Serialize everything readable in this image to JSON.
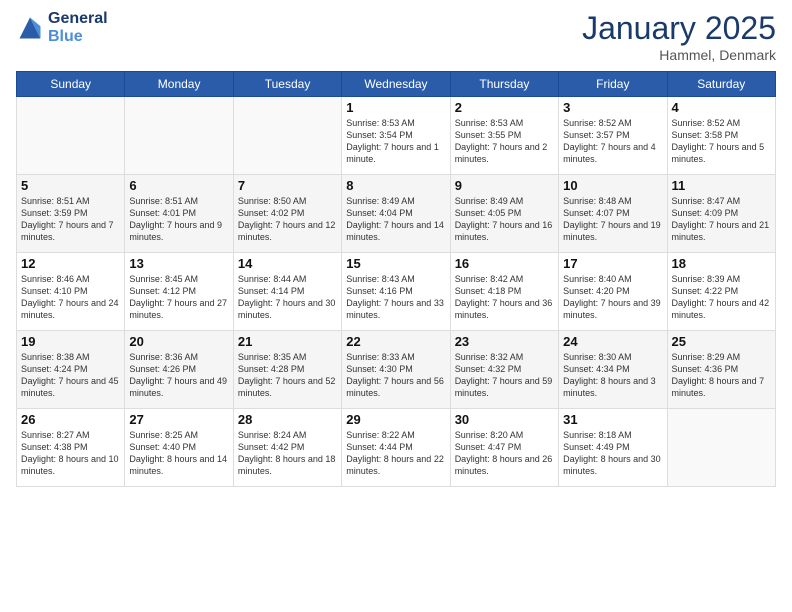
{
  "header": {
    "logo_line1": "General",
    "logo_line2": "Blue",
    "month": "January 2025",
    "location": "Hammel, Denmark"
  },
  "weekdays": [
    "Sunday",
    "Monday",
    "Tuesday",
    "Wednesday",
    "Thursday",
    "Friday",
    "Saturday"
  ],
  "weeks": [
    [
      {
        "day": "",
        "content": ""
      },
      {
        "day": "",
        "content": ""
      },
      {
        "day": "",
        "content": ""
      },
      {
        "day": "1",
        "content": "Sunrise: 8:53 AM\nSunset: 3:54 PM\nDaylight: 7 hours and 1 minute."
      },
      {
        "day": "2",
        "content": "Sunrise: 8:53 AM\nSunset: 3:55 PM\nDaylight: 7 hours and 2 minutes."
      },
      {
        "day": "3",
        "content": "Sunrise: 8:52 AM\nSunset: 3:57 PM\nDaylight: 7 hours and 4 minutes."
      },
      {
        "day": "4",
        "content": "Sunrise: 8:52 AM\nSunset: 3:58 PM\nDaylight: 7 hours and 5 minutes."
      }
    ],
    [
      {
        "day": "5",
        "content": "Sunrise: 8:51 AM\nSunset: 3:59 PM\nDaylight: 7 hours and 7 minutes."
      },
      {
        "day": "6",
        "content": "Sunrise: 8:51 AM\nSunset: 4:01 PM\nDaylight: 7 hours and 9 minutes."
      },
      {
        "day": "7",
        "content": "Sunrise: 8:50 AM\nSunset: 4:02 PM\nDaylight: 7 hours and 12 minutes."
      },
      {
        "day": "8",
        "content": "Sunrise: 8:49 AM\nSunset: 4:04 PM\nDaylight: 7 hours and 14 minutes."
      },
      {
        "day": "9",
        "content": "Sunrise: 8:49 AM\nSunset: 4:05 PM\nDaylight: 7 hours and 16 minutes."
      },
      {
        "day": "10",
        "content": "Sunrise: 8:48 AM\nSunset: 4:07 PM\nDaylight: 7 hours and 19 minutes."
      },
      {
        "day": "11",
        "content": "Sunrise: 8:47 AM\nSunset: 4:09 PM\nDaylight: 7 hours and 21 minutes."
      }
    ],
    [
      {
        "day": "12",
        "content": "Sunrise: 8:46 AM\nSunset: 4:10 PM\nDaylight: 7 hours and 24 minutes."
      },
      {
        "day": "13",
        "content": "Sunrise: 8:45 AM\nSunset: 4:12 PM\nDaylight: 7 hours and 27 minutes."
      },
      {
        "day": "14",
        "content": "Sunrise: 8:44 AM\nSunset: 4:14 PM\nDaylight: 7 hours and 30 minutes."
      },
      {
        "day": "15",
        "content": "Sunrise: 8:43 AM\nSunset: 4:16 PM\nDaylight: 7 hours and 33 minutes."
      },
      {
        "day": "16",
        "content": "Sunrise: 8:42 AM\nSunset: 4:18 PM\nDaylight: 7 hours and 36 minutes."
      },
      {
        "day": "17",
        "content": "Sunrise: 8:40 AM\nSunset: 4:20 PM\nDaylight: 7 hours and 39 minutes."
      },
      {
        "day": "18",
        "content": "Sunrise: 8:39 AM\nSunset: 4:22 PM\nDaylight: 7 hours and 42 minutes."
      }
    ],
    [
      {
        "day": "19",
        "content": "Sunrise: 8:38 AM\nSunset: 4:24 PM\nDaylight: 7 hours and 45 minutes."
      },
      {
        "day": "20",
        "content": "Sunrise: 8:36 AM\nSunset: 4:26 PM\nDaylight: 7 hours and 49 minutes."
      },
      {
        "day": "21",
        "content": "Sunrise: 8:35 AM\nSunset: 4:28 PM\nDaylight: 7 hours and 52 minutes."
      },
      {
        "day": "22",
        "content": "Sunrise: 8:33 AM\nSunset: 4:30 PM\nDaylight: 7 hours and 56 minutes."
      },
      {
        "day": "23",
        "content": "Sunrise: 8:32 AM\nSunset: 4:32 PM\nDaylight: 7 hours and 59 minutes."
      },
      {
        "day": "24",
        "content": "Sunrise: 8:30 AM\nSunset: 4:34 PM\nDaylight: 8 hours and 3 minutes."
      },
      {
        "day": "25",
        "content": "Sunrise: 8:29 AM\nSunset: 4:36 PM\nDaylight: 8 hours and 7 minutes."
      }
    ],
    [
      {
        "day": "26",
        "content": "Sunrise: 8:27 AM\nSunset: 4:38 PM\nDaylight: 8 hours and 10 minutes."
      },
      {
        "day": "27",
        "content": "Sunrise: 8:25 AM\nSunset: 4:40 PM\nDaylight: 8 hours and 14 minutes."
      },
      {
        "day": "28",
        "content": "Sunrise: 8:24 AM\nSunset: 4:42 PM\nDaylight: 8 hours and 18 minutes."
      },
      {
        "day": "29",
        "content": "Sunrise: 8:22 AM\nSunset: 4:44 PM\nDaylight: 8 hours and 22 minutes."
      },
      {
        "day": "30",
        "content": "Sunrise: 8:20 AM\nSunset: 4:47 PM\nDaylight: 8 hours and 26 minutes."
      },
      {
        "day": "31",
        "content": "Sunrise: 8:18 AM\nSunset: 4:49 PM\nDaylight: 8 hours and 30 minutes."
      },
      {
        "day": "",
        "content": ""
      }
    ]
  ]
}
